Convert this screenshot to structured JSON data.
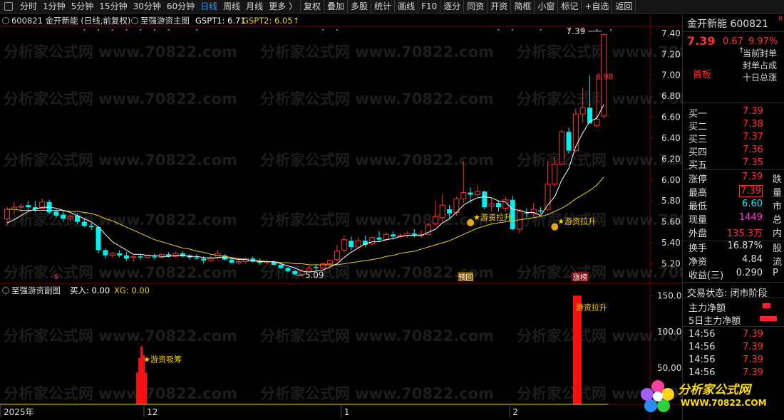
{
  "toolbar": {
    "items": [
      "分时",
      "1分钟",
      "5分钟",
      "15分钟",
      "30分钟",
      "60分钟",
      "日线",
      "周线",
      "月线",
      "更多 〉",
      "复权",
      "叠加",
      "多股",
      "统计",
      "画线",
      "F10",
      "逐分",
      "同资",
      "开资",
      "简框",
      "小窗",
      "标记",
      "+自选",
      "返回"
    ],
    "active": "日线"
  },
  "header": {
    "stock": "600821 金开新能 (日线,前复权)",
    "indicator": "至强游资主图",
    "gspt1": "GSPT1: 6.71",
    "gspt2": "GSPT2: 6.05"
  },
  "sub_header": {
    "name": "至强游资副图",
    "buy": "买入: 0.00",
    "xg": "XG: 0.00"
  },
  "watermark": "分析家公式网 www.70822.com",
  "chart_data": {
    "type": "candlestick",
    "ylim": [
      5.02,
      7.46
    ],
    "yticks": [
      "7.40",
      "7.20",
      "7.00",
      "6.80",
      "6.60",
      "6.40",
      "6.20",
      "6.00",
      "5.80",
      "5.60",
      "5.40",
      "5.20"
    ],
    "xticks": [
      "2025年",
      "12",
      "1",
      "2"
    ],
    "ohlc": [
      [
        5.63,
        5.74,
        5.57,
        5.72
      ],
      [
        5.72,
        5.79,
        5.68,
        5.74
      ],
      [
        5.74,
        5.77,
        5.69,
        5.75
      ],
      [
        5.76,
        5.8,
        5.71,
        5.74
      ],
      [
        5.74,
        5.8,
        5.69,
        5.72
      ],
      [
        5.73,
        5.82,
        5.72,
        5.79
      ],
      [
        5.79,
        5.81,
        5.67,
        5.69
      ],
      [
        5.7,
        5.72,
        5.64,
        5.66
      ],
      [
        5.67,
        5.71,
        5.6,
        5.63
      ],
      [
        5.63,
        5.67,
        5.6,
        5.65
      ],
      [
        5.66,
        5.68,
        5.58,
        5.6
      ],
      [
        5.6,
        5.63,
        5.55,
        5.56
      ],
      [
        5.56,
        5.59,
        5.52,
        5.55
      ],
      [
        5.55,
        5.56,
        5.3,
        5.33
      ],
      [
        5.33,
        5.35,
        5.25,
        5.28
      ],
      [
        5.28,
        5.31,
        5.26,
        5.3
      ],
      [
        5.3,
        5.33,
        5.26,
        5.28
      ],
      [
        5.28,
        5.31,
        5.23,
        5.25
      ],
      [
        5.26,
        5.28,
        5.22,
        5.27
      ],
      [
        5.27,
        5.29,
        5.24,
        5.26
      ],
      [
        5.26,
        5.29,
        5.25,
        5.28
      ],
      [
        5.27,
        5.3,
        5.24,
        5.26
      ],
      [
        5.26,
        5.3,
        5.25,
        5.29
      ],
      [
        5.29,
        5.31,
        5.26,
        5.27
      ],
      [
        5.27,
        5.32,
        5.26,
        5.3
      ],
      [
        5.3,
        5.32,
        5.26,
        5.27
      ],
      [
        5.28,
        5.29,
        5.24,
        5.26
      ],
      [
        5.26,
        5.29,
        5.24,
        5.25
      ],
      [
        5.25,
        5.27,
        5.2,
        5.23
      ],
      [
        5.23,
        5.28,
        5.22,
        5.26
      ],
      [
        5.26,
        5.33,
        5.24,
        5.3
      ],
      [
        5.28,
        5.29,
        5.23,
        5.24
      ],
      [
        5.24,
        5.26,
        5.2,
        5.21
      ],
      [
        5.21,
        5.25,
        5.19,
        5.22
      ],
      [
        5.22,
        5.26,
        5.2,
        5.25
      ],
      [
        5.25,
        5.27,
        5.21,
        5.22
      ],
      [
        5.22,
        5.25,
        5.19,
        5.21
      ],
      [
        5.21,
        5.24,
        5.19,
        5.22
      ],
      [
        5.22,
        5.23,
        5.18,
        5.19
      ],
      [
        5.19,
        5.21,
        5.15,
        5.16
      ],
      [
        5.16,
        5.17,
        5.12,
        5.13
      ],
      [
        5.13,
        5.14,
        5.09,
        5.1
      ],
      [
        5.1,
        5.15,
        5.09,
        5.13
      ],
      [
        5.13,
        5.18,
        5.12,
        5.16
      ],
      [
        5.17,
        5.2,
        5.14,
        5.16
      ],
      [
        5.16,
        5.21,
        5.15,
        5.2
      ],
      [
        5.2,
        5.24,
        5.18,
        5.23
      ],
      [
        5.24,
        5.38,
        5.22,
        5.32
      ],
      [
        5.33,
        5.47,
        5.31,
        5.43
      ],
      [
        5.42,
        5.46,
        5.33,
        5.36
      ],
      [
        5.36,
        5.45,
        5.34,
        5.42
      ],
      [
        5.42,
        5.47,
        5.36,
        5.38
      ],
      [
        5.39,
        5.46,
        5.38,
        5.45
      ],
      [
        5.45,
        5.51,
        5.41,
        5.43
      ],
      [
        5.43,
        5.5,
        5.42,
        5.48
      ],
      [
        5.48,
        5.51,
        5.43,
        5.46
      ],
      [
        5.46,
        5.49,
        5.44,
        5.47
      ],
      [
        5.47,
        5.51,
        5.45,
        5.49
      ],
      [
        5.49,
        5.53,
        5.45,
        5.47
      ],
      [
        5.47,
        5.52,
        5.45,
        5.48
      ],
      [
        5.48,
        5.59,
        5.47,
        5.57
      ],
      [
        5.58,
        5.8,
        5.56,
        5.65
      ],
      [
        5.64,
        5.86,
        5.6,
        5.76
      ],
      [
        5.72,
        5.76,
        5.64,
        5.68
      ],
      [
        5.69,
        5.84,
        5.66,
        5.82
      ],
      [
        5.82,
        6.18,
        5.78,
        5.88
      ],
      [
        5.88,
        5.93,
        5.78,
        5.86
      ],
      [
        5.86,
        5.95,
        5.84,
        5.89
      ],
      [
        5.89,
        5.9,
        5.72,
        5.74
      ],
      [
        5.75,
        5.83,
        5.7,
        5.77
      ],
      [
        5.78,
        5.8,
        5.7,
        5.74
      ],
      [
        5.73,
        5.84,
        5.7,
        5.81
      ],
      [
        5.81,
        5.85,
        5.52,
        5.53
      ],
      [
        5.53,
        5.72,
        5.49,
        5.7
      ],
      [
        5.69,
        5.73,
        5.64,
        5.68
      ],
      [
        5.68,
        5.78,
        5.65,
        5.72
      ],
      [
        5.71,
        5.74,
        5.68,
        5.7
      ],
      [
        5.72,
        6.18,
        5.71,
        5.96
      ],
      [
        5.96,
        6.22,
        5.94,
        6.15
      ],
      [
        6.15,
        6.48,
        6.14,
        6.46
      ],
      [
        6.46,
        6.5,
        6.25,
        6.28
      ],
      [
        6.28,
        6.68,
        6.26,
        6.63
      ],
      [
        6.63,
        6.88,
        6.55,
        6.69
      ],
      [
        6.69,
        7.0,
        6.62,
        6.54
      ],
      [
        6.52,
        6.98,
        6.5,
        6.58
      ],
      [
        6.61,
        7.39,
        6.59,
        7.39
      ]
    ],
    "ma_short": [
      5.59,
      5.62,
      5.66,
      5.7,
      5.72,
      5.74,
      5.74,
      5.73,
      5.71,
      5.69,
      5.66,
      5.63,
      5.6,
      5.55,
      5.48,
      5.41,
      5.37,
      5.33,
      5.29,
      5.29,
      5.28,
      5.28,
      5.27,
      5.27,
      5.28,
      5.28,
      5.27,
      5.27,
      5.26,
      5.25,
      5.26,
      5.26,
      5.25,
      5.24,
      5.24,
      5.23,
      5.22,
      5.22,
      5.22,
      5.2,
      5.18,
      5.16,
      5.13,
      5.12,
      5.13,
      5.14,
      5.17,
      5.2,
      5.26,
      5.31,
      5.35,
      5.39,
      5.41,
      5.41,
      5.43,
      5.44,
      5.46,
      5.47,
      5.47,
      5.47,
      5.5,
      5.53,
      5.59,
      5.63,
      5.69,
      5.76,
      5.8,
      5.83,
      5.84,
      5.83,
      5.8,
      5.79,
      5.72,
      5.71,
      5.69,
      5.69,
      5.66,
      5.76,
      5.84,
      6.0,
      6.11,
      6.32,
      6.45,
      6.56,
      6.59,
      6.72
    ],
    "ma_long": [
      5.72,
      5.72,
      5.71,
      5.71,
      5.71,
      5.71,
      5.71,
      5.71,
      5.71,
      5.7,
      5.7,
      5.69,
      5.68,
      5.66,
      5.63,
      5.61,
      5.58,
      5.55,
      5.52,
      5.49,
      5.46,
      5.43,
      5.41,
      5.39,
      5.37,
      5.35,
      5.34,
      5.32,
      5.31,
      5.29,
      5.28,
      5.27,
      5.26,
      5.25,
      5.24,
      5.23,
      5.23,
      5.22,
      5.22,
      5.21,
      5.21,
      5.2,
      5.2,
      5.19,
      5.19,
      5.19,
      5.19,
      5.19,
      5.2,
      5.21,
      5.22,
      5.23,
      5.24,
      5.25,
      5.27,
      5.28,
      5.3,
      5.31,
      5.32,
      5.34,
      5.36,
      5.38,
      5.4,
      5.42,
      5.45,
      5.48,
      5.51,
      5.54,
      5.56,
      5.58,
      5.59,
      5.6,
      5.61,
      5.62,
      5.63,
      5.64,
      5.65,
      5.67,
      5.7,
      5.73,
      5.77,
      5.82,
      5.86,
      5.9,
      5.95,
      6.03
    ],
    "annotations": [
      {
        "text": "7.39",
        "value": 7.39
      },
      {
        "text": "6.98",
        "value": 6.98
      },
      {
        "text": "5.09",
        "value": 5.09
      },
      {
        "text": "★游资拉升",
        "value": 5.64
      },
      {
        "text": "★游资拉升",
        "value": 5.6
      }
    ],
    "tags": [
      "预回",
      "涨榜"
    ],
    "sub": {
      "ylim": [
        0,
        165
      ],
      "yticks": [
        "150.0",
        "100.0",
        "50.00"
      ],
      "bars": [
        {
          "label": "★游资吸筹",
          "value": 80
        },
        {
          "label": "游资拉升",
          "value": 150
        }
      ]
    }
  },
  "right_panel": {
    "title": "金开新能 600821",
    "price": "7.39",
    "change": "0.67",
    "pct": "9.97%",
    "board": "首板",
    "seal_lines": [
      "当前封单",
      "封单占成",
      "十日总涨"
    ],
    "bids": [
      {
        "label": "买一",
        "price": "7.39"
      },
      {
        "label": "买二",
        "price": "7.38"
      },
      {
        "label": "买三",
        "price": "7.37"
      },
      {
        "label": "买四",
        "price": "7.36"
      },
      {
        "label": "买五",
        "price": "7.35"
      }
    ],
    "stats": [
      {
        "label": "涨停",
        "value": "7.39",
        "side": "跌"
      },
      {
        "label": "最高",
        "value": "7.39",
        "side": "量"
      },
      {
        "label": "最低",
        "value": "6.60",
        "side": "市"
      },
      {
        "label": "现量",
        "value": "1449",
        "side": "总"
      },
      {
        "label": "外盘",
        "value": "135.3万",
        "side": "内"
      }
    ],
    "stats2": [
      {
        "label": "换手",
        "value": "16.87%",
        "side": "股"
      },
      {
        "label": "净资",
        "value": "4.84",
        "side": "流"
      },
      {
        "label": "收益(三)",
        "value": "0.290",
        "side": "P"
      }
    ],
    "trade_state": "交易状态: 闭市阶段",
    "flow": [
      {
        "label": "主力净额"
      },
      {
        "label": "5日主力净额"
      }
    ],
    "ticks": [
      {
        "time": "14:56",
        "price": "7.39"
      },
      {
        "time": "14:56",
        "price": "7.39"
      },
      {
        "time": "14:56",
        "price": "7.39"
      },
      {
        "time": "14:56",
        "price": "7.39"
      }
    ],
    "logo_cn": "分析家公式网",
    "logo_url": "WWW.70822.COM"
  },
  "colors": {
    "up": "#ff3232",
    "down": "#00f0f0",
    "ma_short": "#ffffff",
    "ma_long": "#e6d21c",
    "grid": "#7a0000"
  }
}
